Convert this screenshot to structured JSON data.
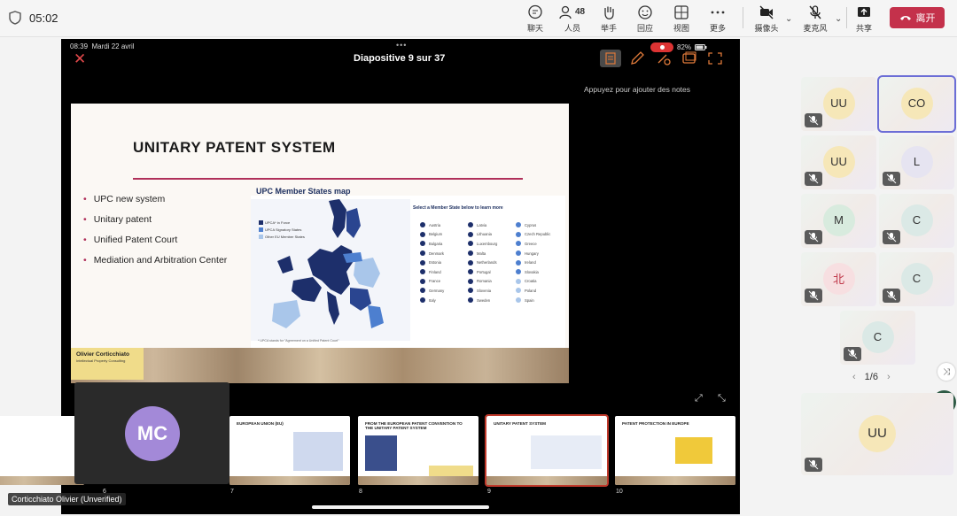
{
  "topbar": {
    "time": "05:02",
    "chat": "聊天",
    "people": "人员",
    "people_count": "48",
    "raise": "举手",
    "react": "回应",
    "view": "视图",
    "more": "更多",
    "camera": "摄像头",
    "mic": "麦克风",
    "share": "共享",
    "leave": "离开"
  },
  "ipad": {
    "time": "08:39",
    "date": "Mardi 22 avril",
    "battery": "82%",
    "slide_title": "Diapositive 9 sur 37",
    "notes_hint": "Appuyez pour ajouter des notes",
    "dots": "•••"
  },
  "slide": {
    "title": "UNITARY PATENT SYSTEM",
    "bullets": [
      "UPC new system",
      "Unitary patent",
      "Unified Patent Court",
      "Mediation and Arbitration Center"
    ],
    "map_title": "UPC Member States map",
    "select_title": "Select a Member State below to learn more",
    "legend": [
      "UPCA* in Force",
      "UPCA Signatory States",
      "Other EU Member States"
    ],
    "countries_col1": [
      "Austria",
      "Belgium",
      "Bulgaria",
      "Denmark",
      "Estonia",
      "Finland",
      "France",
      "Germany",
      "Italy"
    ],
    "countries_col2": [
      "Latvia",
      "Lithuania",
      "Luxembourg",
      "Malta",
      "Netherlands",
      "Portugal",
      "Romania",
      "Slovenia",
      "Sweden"
    ],
    "countries_col3": [
      "Cyprus",
      "Czech Republic",
      "Greece",
      "Hungary",
      "Ireland",
      "Slovakia",
      "Croatia",
      "Poland",
      "Spain"
    ],
    "map_note": "* UPCA stands for \"Agreement on a Unified Patent Court\"",
    "author": "Olivier  Corticchiato",
    "author_sub": "Intellectual Property Consulting"
  },
  "thumbnails": [
    {
      "num": "6",
      "title": ""
    },
    {
      "num": "7",
      "title": "European Union (EU)"
    },
    {
      "num": "8",
      "title": "From the European Patent Convention to the Unitary Patent System"
    },
    {
      "num": "9",
      "title": "Unitary Patent System"
    },
    {
      "num": "10",
      "title": "Patent protection in Europe"
    }
  ],
  "presenter": {
    "initials": "MC",
    "label": "Corticchiato Olivier (Unverified)"
  },
  "participants": [
    {
      "initials": "UU"
    },
    {
      "initials": "CO"
    },
    {
      "initials": "UU"
    },
    {
      "initials": "L"
    },
    {
      "initials": "M"
    },
    {
      "initials": "C"
    },
    {
      "initials": "北"
    },
    {
      "initials": "C"
    },
    {
      "initials": "C"
    }
  ],
  "pager": {
    "text": "1/6"
  },
  "bottom_tile": {
    "initials": "UU"
  },
  "colors": {
    "leave": "#c4314b",
    "active_tile": "#6c6ed6",
    "upc_force": "#1d2f6b",
    "upc_signatory": "#4d7fcf",
    "other_eu": "#a9c6ea"
  }
}
